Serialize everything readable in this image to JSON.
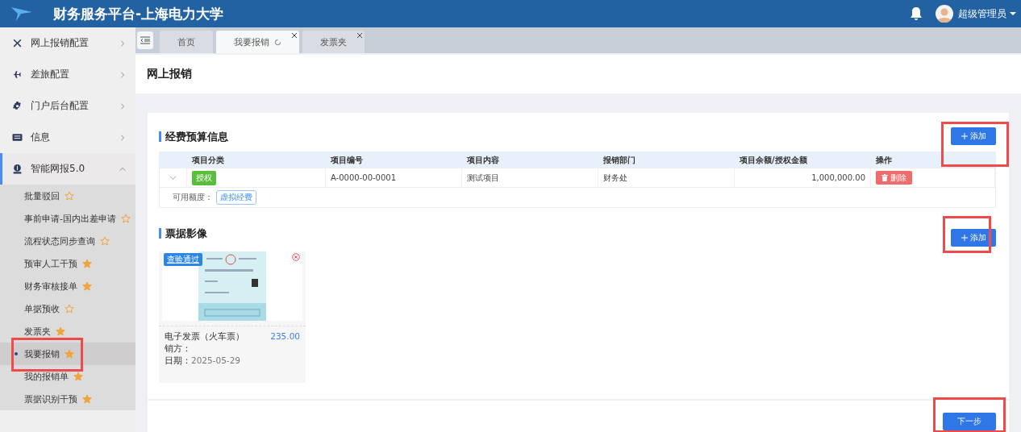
{
  "header": {
    "title": "财务服务平台-上海电力大学",
    "user": "超级管理员"
  },
  "sidebar": {
    "items": [
      {
        "label": "网上报销配置",
        "expanded": false,
        "selected": false
      },
      {
        "label": "差旅配置",
        "expanded": false,
        "selected": false
      },
      {
        "label": "门户后台配置",
        "expanded": false,
        "selected": false
      },
      {
        "label": "信息",
        "expanded": false,
        "selected": false
      },
      {
        "label": "智能网报5.0",
        "expanded": true,
        "selected": true,
        "children": [
          {
            "label": "批量驳回",
            "starred": false,
            "selected": false,
            "highlighted": false
          },
          {
            "label": "事前申请-国内出差申请",
            "starred": false,
            "selected": false,
            "highlighted": false
          },
          {
            "label": "流程状态同步查询",
            "starred": false,
            "selected": false,
            "highlighted": false
          },
          {
            "label": "预审人工干预",
            "starred": true,
            "selected": false,
            "highlighted": false
          },
          {
            "label": "财务审核接单",
            "starred": true,
            "selected": false,
            "highlighted": false
          },
          {
            "label": "单据预收",
            "starred": false,
            "selected": false,
            "highlighted": false
          },
          {
            "label": "发票夹",
            "starred": true,
            "selected": false,
            "highlighted": false
          },
          {
            "label": "我要报销",
            "starred": true,
            "selected": true,
            "highlighted": true
          },
          {
            "label": "我的报销单",
            "starred": true,
            "selected": false,
            "highlighted": false
          },
          {
            "label": "票据识别干预",
            "starred": true,
            "selected": false,
            "highlighted": false
          }
        ]
      }
    ]
  },
  "tabs": [
    {
      "label": "首页",
      "selected": false,
      "closable": false
    },
    {
      "label": "我要报销",
      "selected": true,
      "closable": true
    },
    {
      "label": "发票夹",
      "selected": false,
      "closable": true
    }
  ],
  "page_title": "网上报销",
  "budget": {
    "title": "经费预算信息",
    "add_button": {
      "label": "添加",
      "highlighted": true
    },
    "columns": [
      "项目分类",
      "项目编号",
      "项目内容",
      "报销部门",
      "项目余额/授权金额",
      "操作"
    ],
    "rows": [
      {
        "category": "授权",
        "number": "A-0000-00-0001",
        "content": "测试项目",
        "department": "财务处",
        "amount": "1,000,000.00",
        "action": "删除",
        "expanded": false
      }
    ],
    "available_label": "可用额度：",
    "available_tag": "虚拟经费"
  },
  "invoices": {
    "title": "票据影像",
    "add_button": {
      "label": "添加",
      "highlighted": true
    },
    "items": [
      {
        "badge": "查验通过",
        "name": "电子发票（火车票）",
        "amount": "235.00",
        "seller_label": "销方：",
        "date_label": "日期：",
        "date": "2025-05-29"
      }
    ]
  },
  "footer": {
    "next_button": {
      "label": "下一步",
      "highlighted": true
    }
  }
}
